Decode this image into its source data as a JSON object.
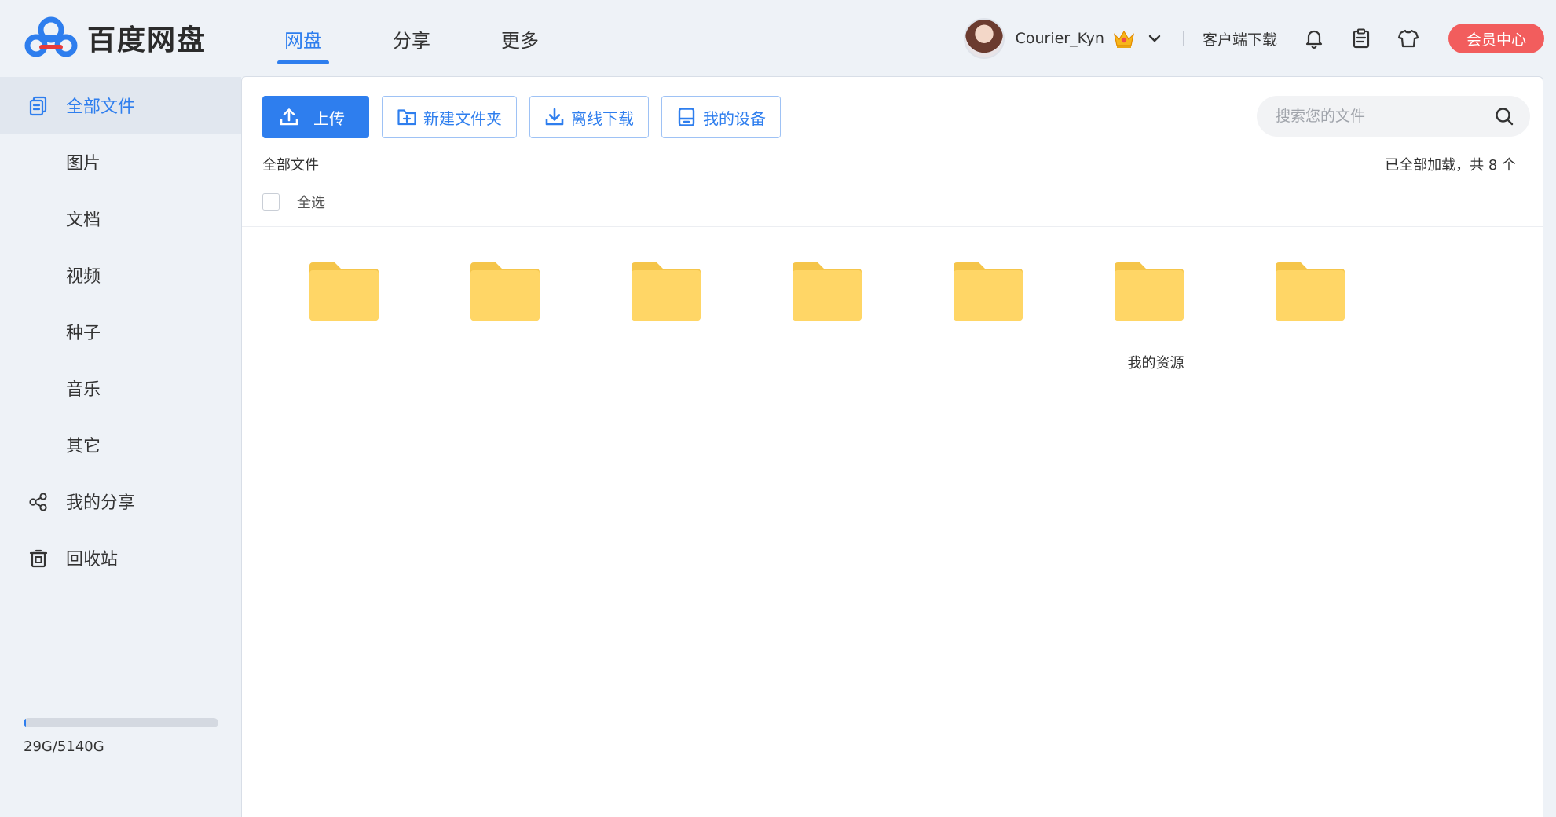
{
  "app": {
    "logo_text": "百度网盘"
  },
  "nav": {
    "tabs": [
      {
        "label": "网盘",
        "active": true
      },
      {
        "label": "分享",
        "active": false
      },
      {
        "label": "更多",
        "active": false
      }
    ]
  },
  "user": {
    "name": "Courier_Kyn",
    "client_download": "客户端下载",
    "vip_button": "会员中心"
  },
  "sidebar": {
    "items": [
      {
        "label": "全部文件",
        "icon": "files-icon",
        "active": true
      },
      {
        "label": "图片"
      },
      {
        "label": "文档"
      },
      {
        "label": "视频"
      },
      {
        "label": "种子"
      },
      {
        "label": "音乐"
      },
      {
        "label": "其它"
      },
      {
        "label": "我的分享",
        "icon": "share-icon"
      },
      {
        "label": "回收站",
        "icon": "trash-icon"
      }
    ],
    "storage": {
      "text": "29G/5140G",
      "used_fraction": 0.0056
    }
  },
  "toolbar": {
    "upload": "上传",
    "new_folder": "新建文件夹",
    "offline_download": "离线下载",
    "my_devices": "我的设备"
  },
  "search": {
    "placeholder": "搜索您的文件"
  },
  "content": {
    "breadcrumb": "全部文件",
    "load_status": "已全部加载，共 8 个",
    "select_all": "全选",
    "folders": [
      {
        "name": ""
      },
      {
        "name": ""
      },
      {
        "name": ""
      },
      {
        "name": ""
      },
      {
        "name": ""
      },
      {
        "name": "我的资源"
      },
      {
        "name": ""
      }
    ]
  },
  "colors": {
    "accent": "#2e7eee",
    "vip": "#f25d5d",
    "folder": "#ffd666",
    "folder_tab": "#f5c54a"
  }
}
